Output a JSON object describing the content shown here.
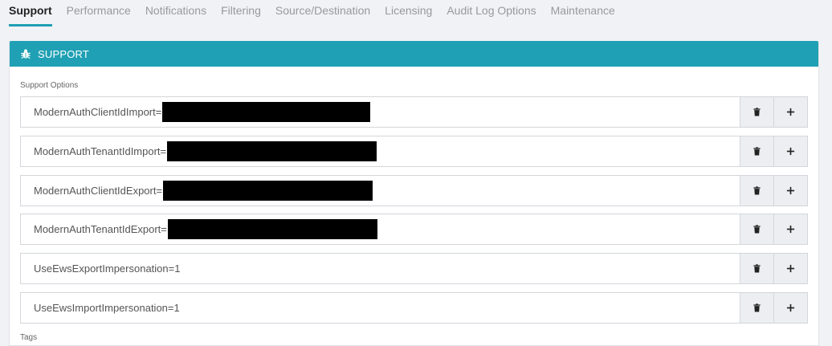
{
  "tabs": [
    {
      "label": "Support",
      "active": true
    },
    {
      "label": "Performance",
      "active": false
    },
    {
      "label": "Notifications",
      "active": false
    },
    {
      "label": "Filtering",
      "active": false
    },
    {
      "label": "Source/Destination",
      "active": false
    },
    {
      "label": "Licensing",
      "active": false
    },
    {
      "label": "Audit Log Options",
      "active": false
    },
    {
      "label": "Maintenance",
      "active": false
    }
  ],
  "panel": {
    "title": "SUPPORT",
    "icon": "bug-icon",
    "accent_color": "#1fa0b4",
    "section_label": "Support Options",
    "next_section_label": "Tags"
  },
  "options": [
    {
      "value": "ModernAuthClientIdImport=",
      "redacted": true
    },
    {
      "value": "ModernAuthTenantIdImport=",
      "redacted": true
    },
    {
      "value": "ModernAuthClientIdExport=",
      "redacted": true
    },
    {
      "value": "ModernAuthTenantIdExport=",
      "redacted": true
    },
    {
      "value": "UseEwsExportImpersonation=1",
      "redacted": false
    },
    {
      "value": "UseEwsImportImpersonation=1",
      "redacted": false
    }
  ],
  "row_buttons": {
    "delete_icon": "trash-icon",
    "add_icon": "plus-icon"
  }
}
